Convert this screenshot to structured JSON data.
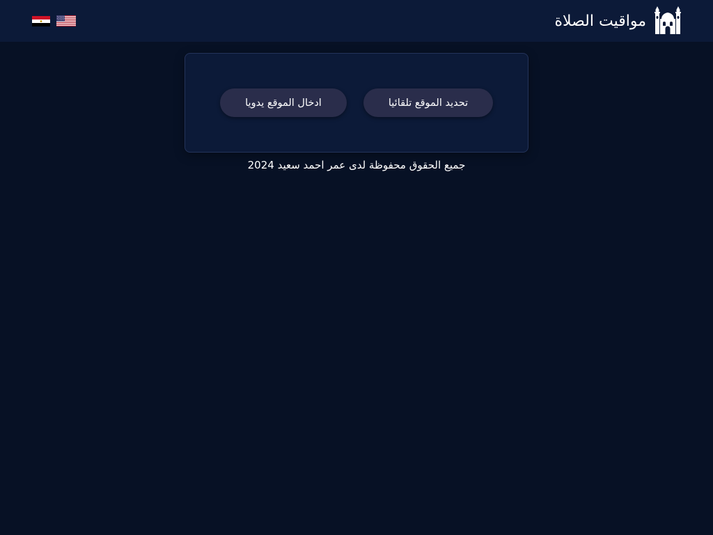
{
  "header": {
    "title": "مواقيت الصلاة",
    "logo_icon": "mosque-icon",
    "languages": [
      {
        "code": "ar-EG",
        "icon": "egypt-flag-icon"
      },
      {
        "code": "en-US",
        "icon": "usa-flag-icon"
      }
    ]
  },
  "location_card": {
    "auto_button_label": "تحديد الموقع تلقائيا",
    "manual_button_label": "ادخال الموقع يدويا"
  },
  "footer": {
    "copyright": "جميع الحقوق محفوظة لدى عمر احمد سعيد 2024"
  },
  "colors": {
    "background": "#071125",
    "header_background": "#0c1a38",
    "card_background": "#0c1a38",
    "button_background": "#2a2d4b",
    "text": "#ffffff"
  }
}
